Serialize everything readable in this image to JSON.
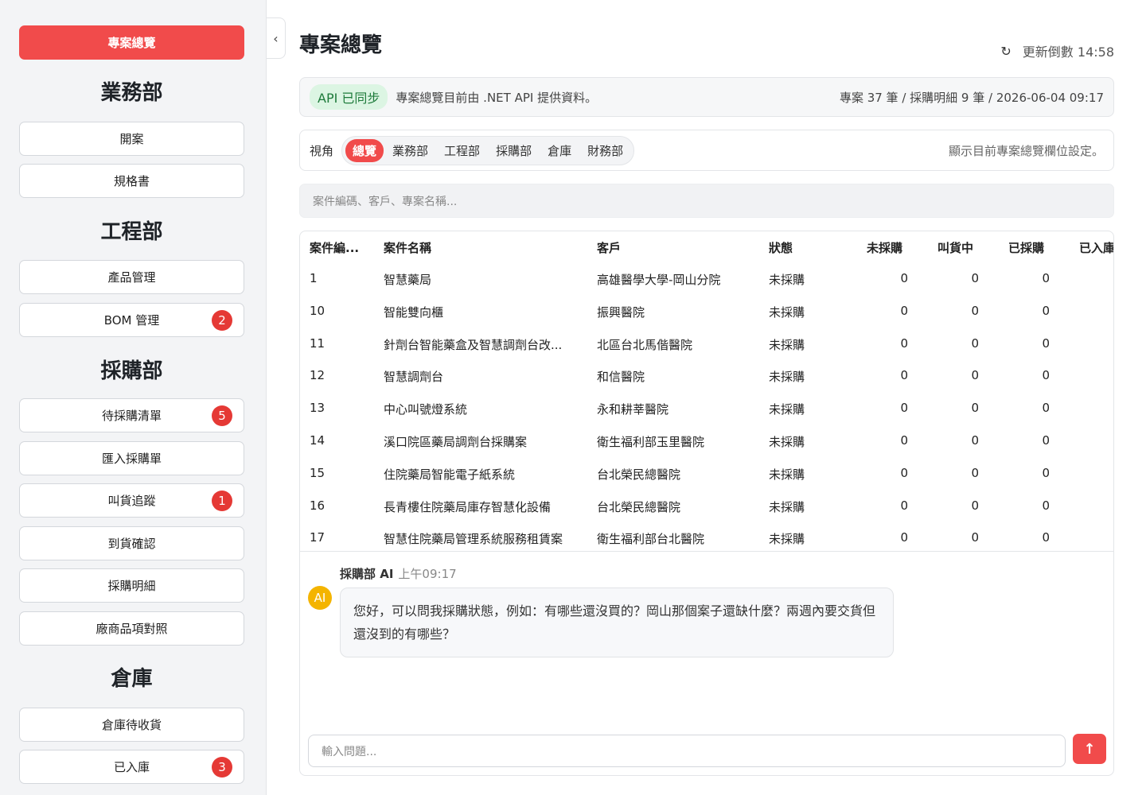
{
  "sidebar": {
    "overview": "專案總覽",
    "sections": [
      {
        "title": "業務部",
        "items": [
          {
            "label": "開案"
          },
          {
            "label": "規格書"
          }
        ]
      },
      {
        "title": "工程部",
        "items": [
          {
            "label": "產品管理"
          },
          {
            "label": "BOM 管理",
            "badge": "2"
          }
        ]
      },
      {
        "title": "採購部",
        "items": [
          {
            "label": "待採購清單",
            "badge": "5"
          },
          {
            "label": "匯入採購單"
          },
          {
            "label": "叫貨追蹤",
            "badge": "1"
          },
          {
            "label": "到貨確認"
          },
          {
            "label": "採購明細"
          },
          {
            "label": "廠商品項對照"
          }
        ]
      },
      {
        "title": "倉庫",
        "items": [
          {
            "label": "倉庫待收貨"
          },
          {
            "label": "已入庫",
            "badge": "3"
          }
        ]
      }
    ],
    "collapse_icon": "‹"
  },
  "header": {
    "title": "專案總覽",
    "refresh_icon": "↻",
    "refresh_text": "更新倒數 14:58"
  },
  "api": {
    "badge": "API 已同步",
    "text": "專案總覽目前由 .NET API 提供資料。",
    "meta": "專案 37 筆 / 採購明細 9 筆 / 2026-06-04 09:17"
  },
  "view": {
    "label": "視角",
    "tabs": [
      "總覽",
      "業務部",
      "工程部",
      "採購部",
      "倉庫",
      "財務部"
    ],
    "active": 0,
    "note": "顯示目前專案總覽欄位設定。"
  },
  "search": {
    "placeholder": "案件編碼、客戶、專案名稱..."
  },
  "table": {
    "headers": [
      "案件編...",
      "案件名稱",
      "客戶",
      "狀態",
      "未採購",
      "叫貨中",
      "已採購",
      "已入庫"
    ],
    "rows": [
      [
        "1",
        "智慧藥局",
        "高雄醫學大學-岡山分院",
        "未採購",
        "0",
        "0",
        "0"
      ],
      [
        "10",
        "智能雙向櫃",
        "振興醫院",
        "未採購",
        "0",
        "0",
        "0"
      ],
      [
        "11",
        "針劑台智能藥盒及智慧調劑台改...",
        "北區台北馬偕醫院",
        "未採購",
        "0",
        "0",
        "0"
      ],
      [
        "12",
        "智慧調劑台",
        "和信醫院",
        "未採購",
        "0",
        "0",
        "0"
      ],
      [
        "13",
        "中心叫號燈系統",
        "永和耕莘醫院",
        "未採購",
        "0",
        "0",
        "0"
      ],
      [
        "14",
        "溪口院區藥局調劑台採購案",
        "衛生福利部玉里醫院",
        "未採購",
        "0",
        "0",
        "0"
      ],
      [
        "15",
        "住院藥局智能電子紙系統",
        "台北榮民總醫院",
        "未採購",
        "0",
        "0",
        "0"
      ],
      [
        "16",
        "長青樓住院藥局庫存智慧化設備",
        "台北榮民總醫院",
        "未採購",
        "0",
        "0",
        "0"
      ],
      [
        "17",
        "智慧住院藥局管理系統服務租賃案",
        "衛生福利部台北醫院",
        "未採購",
        "0",
        "0",
        "0"
      ]
    ]
  },
  "chat": {
    "avatar": "AI",
    "sender": "採購部 AI",
    "time": "上午09:17",
    "message": "您好，可以問我採購狀態，例如：有哪些還沒買的？岡山那個案子還缺什麼？兩週內要交貨但還沒到的有哪些？",
    "input_placeholder": "輸入問題...",
    "send_icon": "↑"
  }
}
